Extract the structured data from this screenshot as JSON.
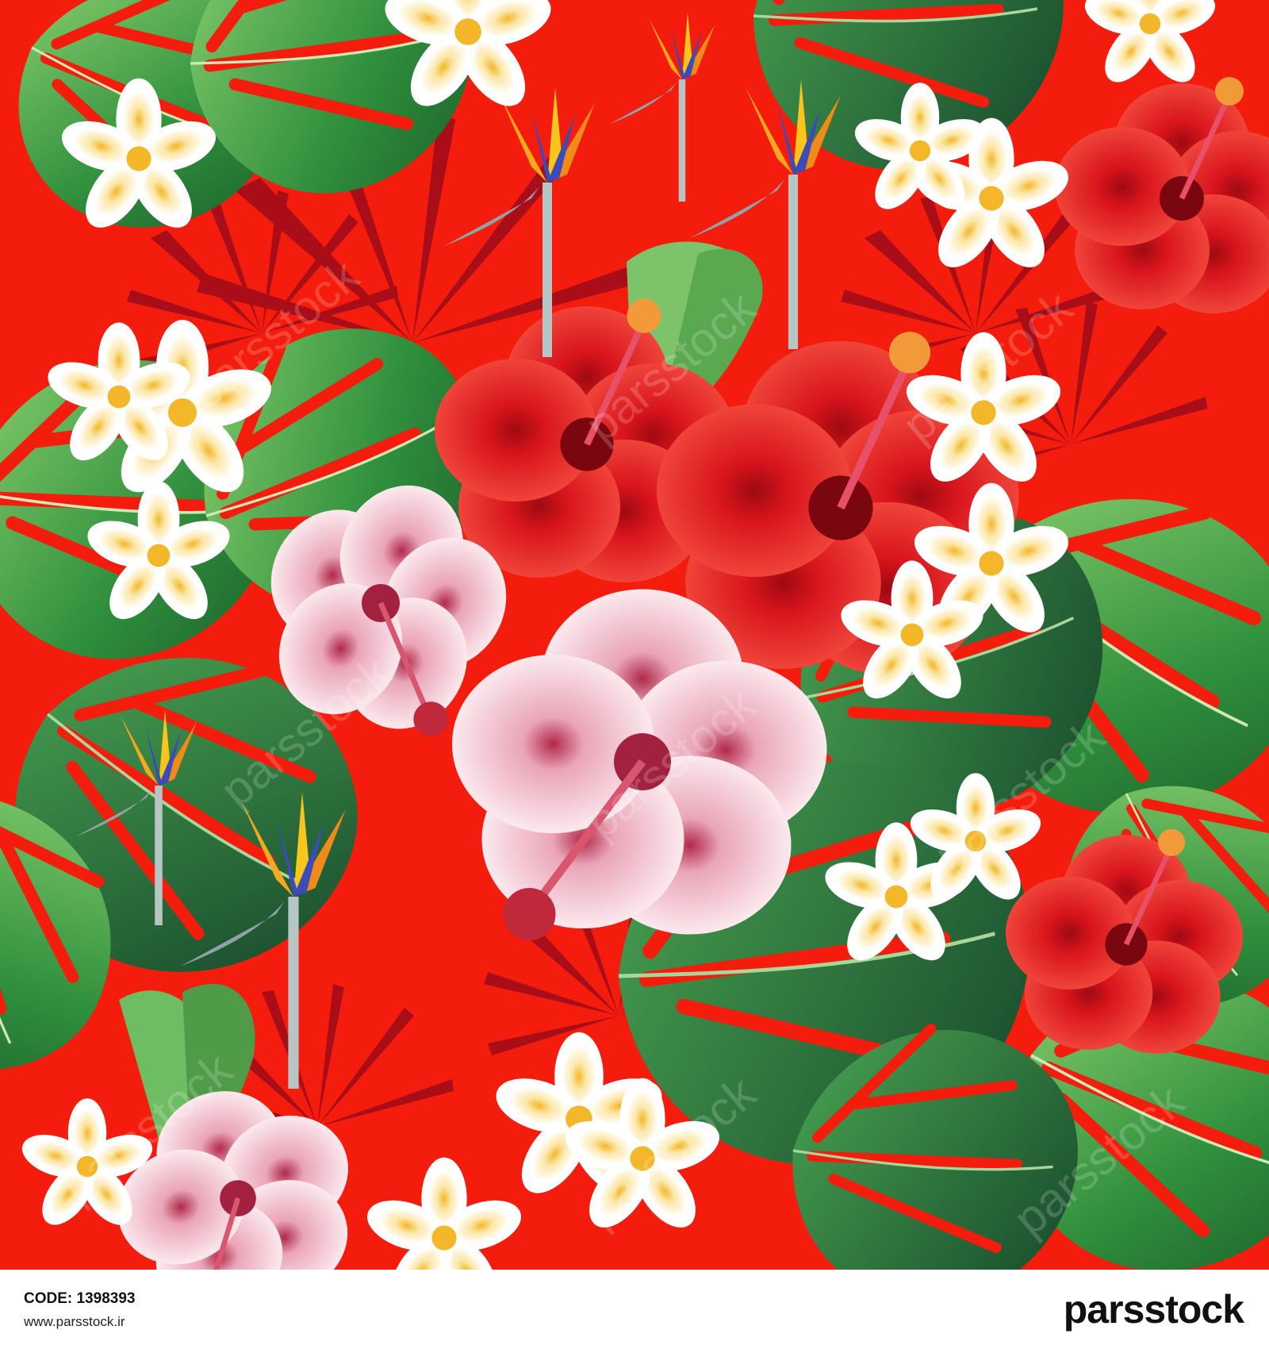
{
  "image": {
    "description_colors": {
      "background_red": "#f41c0c",
      "leaf_green": "#2f8f3c",
      "leaf_light": "#7cc36a",
      "hibiscus_red": "#e31b1b",
      "hibiscus_pink": "#f3c9d4",
      "plumeria_white": "#fbf7f2",
      "plumeria_center": "#f6c23c",
      "bird_orange": "#f7a81c",
      "bird_blue": "#3c4bb8"
    },
    "watermark": "parsstock"
  },
  "footer": {
    "code_label": "CODE:",
    "code_value": "1398393",
    "url": "www.parsstock.ir",
    "brand": "parsstock"
  }
}
